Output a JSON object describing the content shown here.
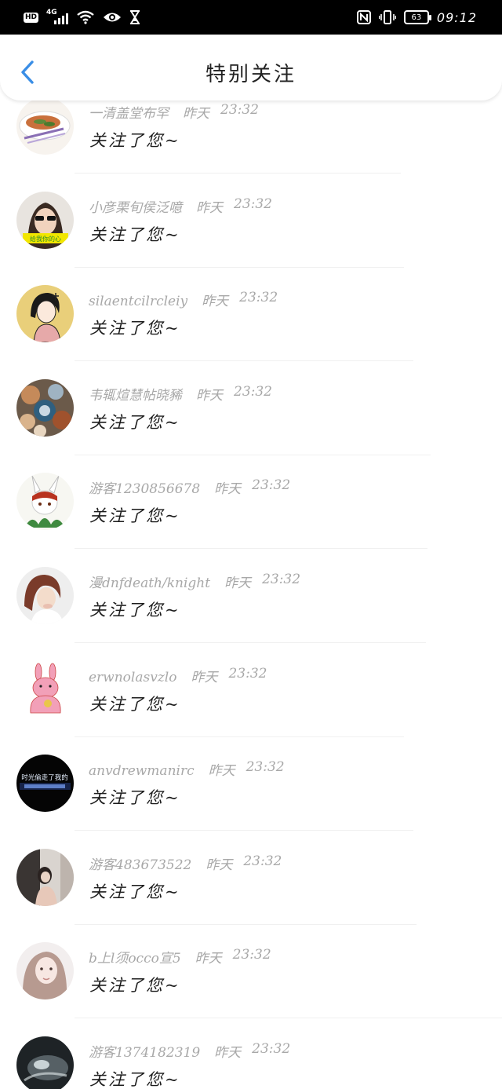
{
  "status_bar": {
    "hd": "HD",
    "network": "4G",
    "battery": "63",
    "time": "09:12",
    "icons": [
      "hd-icon",
      "signal-icon",
      "wifi-icon",
      "eye-icon",
      "hourglass-icon",
      "nfc-icon",
      "vibrate-icon",
      "battery-icon"
    ]
  },
  "header": {
    "title": "特别关注",
    "back_icon": "chevron-left-icon",
    "accent_color": "#3a8ee6"
  },
  "notifications": [
    {
      "name": "一清盖堂布罕",
      "day": "昨天",
      "time": "23:32",
      "message": "关注了您~"
    },
    {
      "name": "小彦栗旬侯泛噫",
      "day": "昨天",
      "time": "23:32",
      "message": "关注了您~"
    },
    {
      "name": "silaentcilrcleiy",
      "day": "昨天",
      "time": "23:32",
      "message": "关注了您~"
    },
    {
      "name": "韦辄煊慧帖晓豨",
      "day": "昨天",
      "time": "23:32",
      "message": "关注了您~"
    },
    {
      "name": "游客1230856678",
      "day": "昨天",
      "time": "23:32",
      "message": "关注了您~"
    },
    {
      "name": "漫dnfdeath/knight",
      "day": "昨天",
      "time": "23:32",
      "message": "关注了您~"
    },
    {
      "name": "erwnolasvzlo",
      "day": "昨天",
      "time": "23:32",
      "message": "关注了您~"
    },
    {
      "name": "anvdrewmanirc",
      "day": "昨天",
      "time": "23:32",
      "message": "关注了您~"
    },
    {
      "name": "游客483673522",
      "day": "昨天",
      "time": "23:32",
      "message": "关注了您~"
    },
    {
      "name": "b上l须occo宣5",
      "day": "昨天",
      "time": "23:32",
      "message": "关注了您~"
    },
    {
      "name": "游客1374182319",
      "day": "昨天",
      "time": "23:32",
      "message": "关注了您~"
    }
  ],
  "avatar_texts": {
    "heart_sticker": "给我你的心",
    "dark_caption_line1": "时光偷走了我的"
  }
}
